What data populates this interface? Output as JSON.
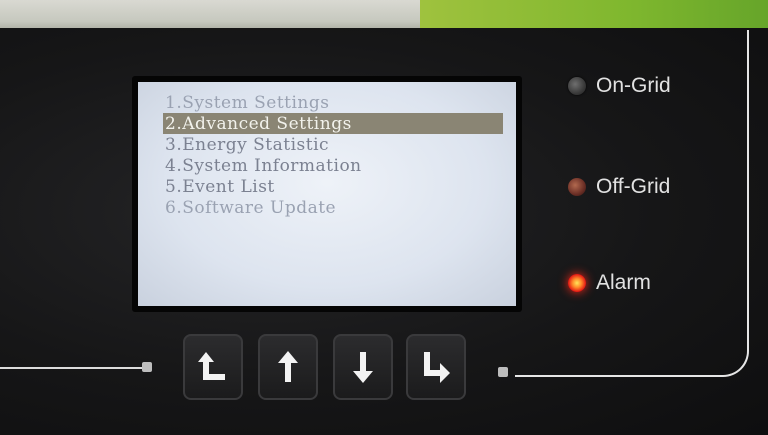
{
  "screen": {
    "menu": [
      {
        "label": "1.System Settings"
      },
      {
        "label": "2.Advanced Settings",
        "selected": true
      },
      {
        "label": "3.Energy Statistic"
      },
      {
        "label": "4.System Information"
      },
      {
        "label": "5.Event List"
      },
      {
        "label": "6.Software Update"
      }
    ]
  },
  "indicators": {
    "on_grid": {
      "label": "On-Grid",
      "state": "off",
      "color": "#5a5a5a"
    },
    "off_grid": {
      "label": "Off-Grid",
      "state": "dim",
      "color": "#7a3024"
    },
    "alarm": {
      "label": "Alarm",
      "state": "on",
      "color": "#e31414"
    }
  },
  "buttons": [
    {
      "name": "back-button",
      "icon": "return-up-icon"
    },
    {
      "name": "up-button",
      "icon": "arrow-up-icon"
    },
    {
      "name": "down-button",
      "icon": "arrow-down-icon"
    },
    {
      "name": "enter-button",
      "icon": "enter-icon"
    }
  ],
  "colors": {
    "accent_green": "#7fb72e",
    "lcd_bg": "#e4e9f2",
    "selection": "#8a8574"
  }
}
